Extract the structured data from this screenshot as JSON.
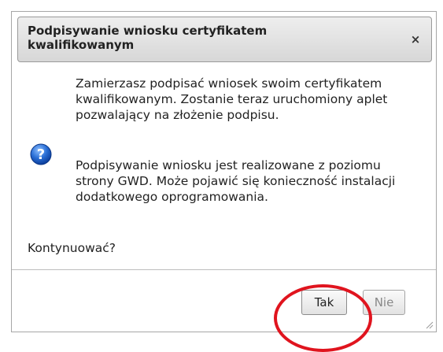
{
  "dialog": {
    "title": "Podpisywanie wniosku certyfikatem kwalifikowanym",
    "close_label": "×",
    "message_1": "Zamierzasz podpisać wniosek swoim certyfikatem kwalifikowanym. Zostanie teraz uruchomiony aplet pozwalający na złożenie podpisu.",
    "message_2": "Podpisywanie wniosku jest realizowane z poziomu strony GWD. Może pojawić się konieczność instalacji dodatkowego oprogramowania.",
    "question": "Kontynuować?",
    "buttons": {
      "yes_label": "Tak",
      "no_label": "Nie"
    },
    "icon": "question-icon"
  },
  "colors": {
    "highlight_circle": "#e0141e",
    "icon_blue": "#1a5fc8"
  }
}
